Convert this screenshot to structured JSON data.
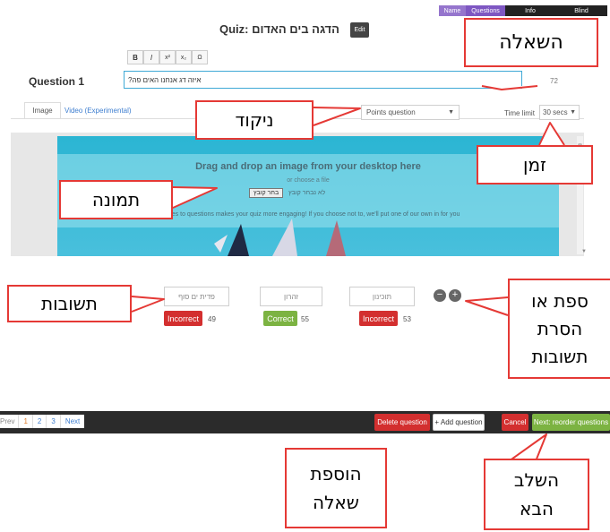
{
  "top_tabs": [
    "Name",
    "Questions",
    "Info",
    "Blind"
  ],
  "quiz": {
    "title": "Quiz: הדגה בים האדום",
    "edit_label": "Edit"
  },
  "toolbar": [
    "B",
    "I",
    "x²",
    "x₂",
    "Ω"
  ],
  "question": {
    "label": "Question 1",
    "text": "?איזה דג אנחנו האים פה",
    "char_count": "72"
  },
  "media_tabs": [
    "Image",
    "Video (Experimental)"
  ],
  "points_select": "Points question",
  "time": {
    "label": "Time limit",
    "value": "30 secs"
  },
  "dropzone": {
    "headline": "Drag and drop an image from your desktop here",
    "sub": "or choose a file",
    "no_file": "לא נבחר קובץ",
    "choose_btn": "בחר קובץ",
    "hint": "ages to questions makes your quiz more engaging! If you choose not to, we'll put one of our own in for you"
  },
  "answers": [
    {
      "text": "פדית ים סוף",
      "status": "Incorrect",
      "count": "49"
    },
    {
      "text": "זהרון",
      "status": "Correct",
      "count": "55"
    },
    {
      "text": "תוכינון",
      "status": "Incorrect",
      "count": "53"
    }
  ],
  "pagination": {
    "prev": "Prev",
    "pages": [
      "1",
      "2",
      "3"
    ],
    "next": "Next"
  },
  "bottom_buttons": {
    "delete": "Delete question",
    "add": "+ Add question",
    "cancel": "Cancel",
    "next": "Next: reorder questions"
  },
  "callouts": {
    "question": "השאלה",
    "points": "ניקוד",
    "time": "זמן",
    "image": "תמונה",
    "answers": "תשובות",
    "add_remove_line1": "ספת או",
    "add_remove_line2": "הסרת",
    "add_remove_line3": "תשובות",
    "add_question_line1": "הוספת",
    "add_question_line2": "שאלה",
    "next_step_line1": "השלב",
    "next_step_line2": "הבא"
  },
  "colors": {
    "purple_tab": "#7e57c2",
    "dark_tab": "#222222",
    "incorrect": "#d32f2f",
    "correct": "#7cb342",
    "footer": "#2b2b2b",
    "callout_border": "#e53935",
    "dropzone_sky": "#29b6d6"
  }
}
